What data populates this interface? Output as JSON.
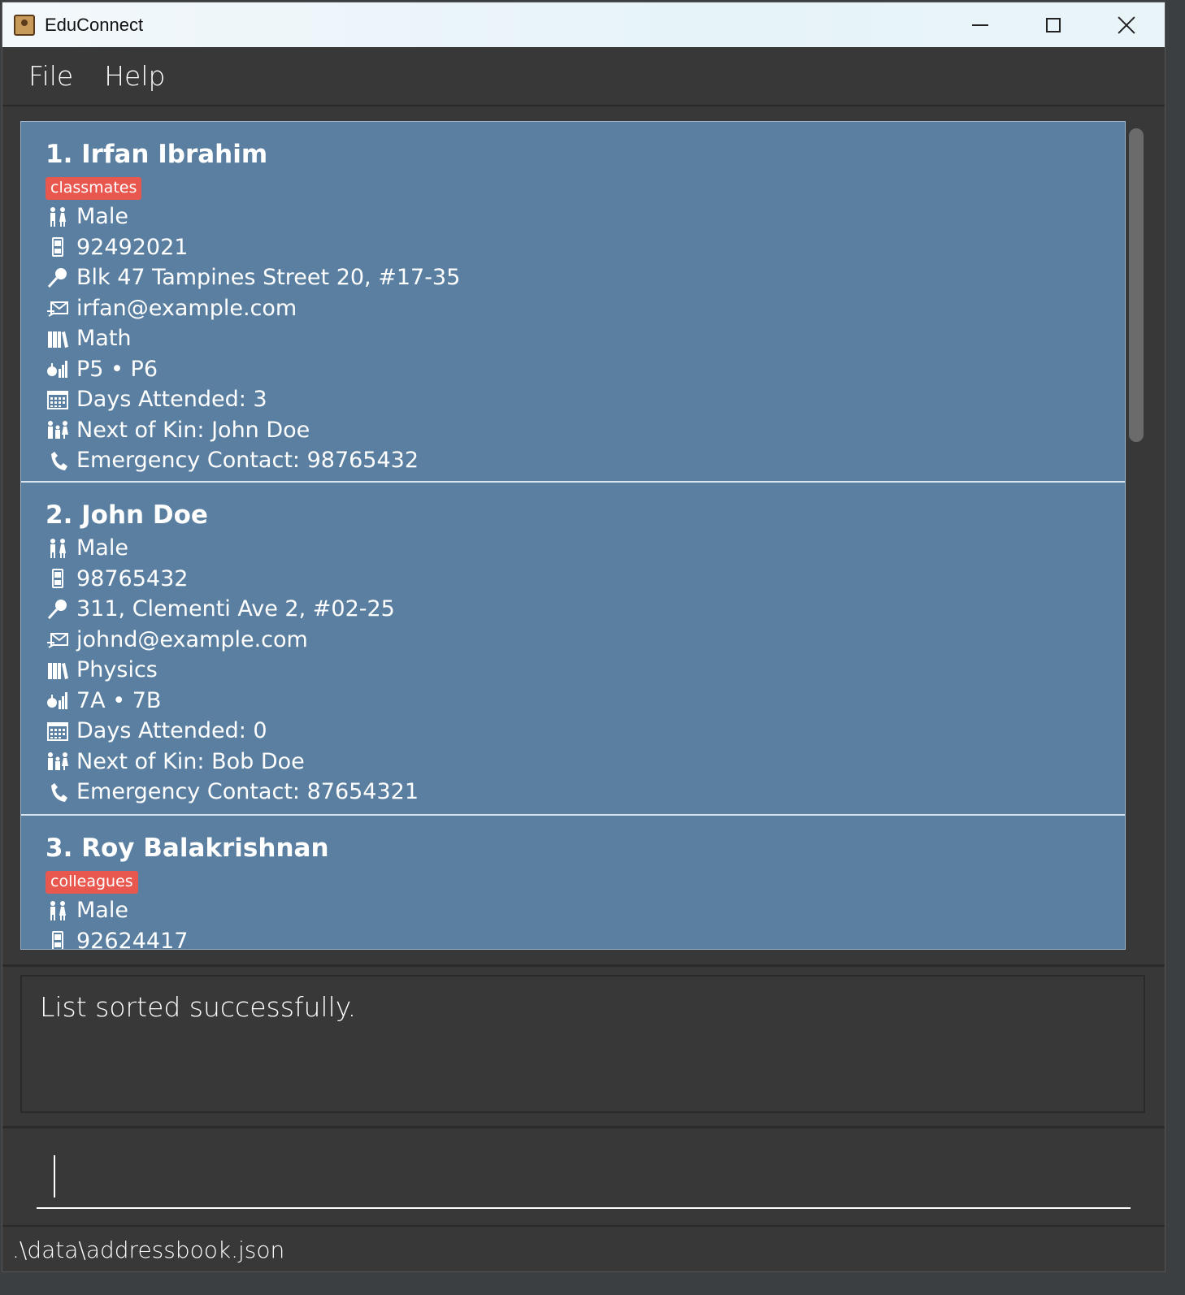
{
  "window": {
    "title": "EduConnect"
  },
  "menu": {
    "file": "File",
    "help": "Help"
  },
  "persons": [
    {
      "name": "1. Irfan Ibrahim",
      "tag": "classmates",
      "gender": "Male",
      "phone": "92492021",
      "address": "Blk 47 Tampines Street 20, #17-35",
      "email": "irfan@example.com",
      "subject": "Math",
      "classes": "P5 • P6",
      "days": "Days Attended: 3",
      "nok": "Next of Kin: John Doe",
      "emergency": "Emergency Contact: 98765432"
    },
    {
      "name": "2. John Doe",
      "gender": "Male",
      "phone": "98765432",
      "address": "311, Clementi Ave 2, #02-25",
      "email": "johnd@example.com",
      "subject": "Physics",
      "classes": "7A • 7B",
      "days": "Days Attended: 0",
      "nok": "Next of Kin: Bob Doe",
      "emergency": "Emergency Contact: 87654321"
    },
    {
      "name": "3. Roy Balakrishnan",
      "tag": "colleagues",
      "gender": "Male",
      "phone": "92624417"
    }
  ],
  "result": {
    "message": "List sorted successfully."
  },
  "command": {
    "value": ""
  },
  "status": {
    "path": ".\\data\\addressbook.json"
  },
  "colors": {
    "card_bg": "#5a7fa0",
    "tag_bg": "#e8584f",
    "app_bg": "#383838"
  },
  "icons": {
    "gender": "gender-icon",
    "phone": "phone-icon",
    "address": "address-pin-icon",
    "email": "email-icon",
    "subject": "books-icon",
    "classes": "classes-icon",
    "days": "calendar-icon",
    "nok": "family-icon",
    "emergency": "telephone-icon"
  }
}
